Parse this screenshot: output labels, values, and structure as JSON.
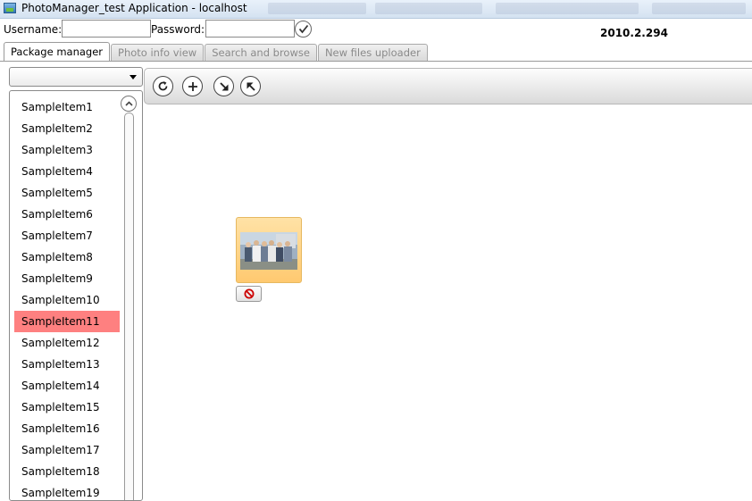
{
  "window": {
    "title": "PhotoManager_test Application - localhost"
  },
  "login": {
    "username_label": "Username:",
    "username_value": "",
    "password_label": "Password:",
    "password_value": "",
    "submit_icon": "checkmark-icon"
  },
  "version": "2010.2.294",
  "tabs": [
    {
      "label": "Package manager",
      "active": true
    },
    {
      "label": "Photo info view",
      "active": false
    },
    {
      "label": "Search and browse",
      "active": false
    },
    {
      "label": "New files uploader",
      "active": false
    }
  ],
  "package_selector": {
    "selected_value": ""
  },
  "items": [
    {
      "label": "SampleItem1"
    },
    {
      "label": "SampleItem2"
    },
    {
      "label": "SampleItem3"
    },
    {
      "label": "SampleItem4"
    },
    {
      "label": "SampleItem5"
    },
    {
      "label": "SampleItem6"
    },
    {
      "label": "SampleItem7"
    },
    {
      "label": "SampleItem8"
    },
    {
      "label": "SampleItem9"
    },
    {
      "label": "SampleItem10"
    },
    {
      "label": "SampleItem11"
    },
    {
      "label": "SampleItem12"
    },
    {
      "label": "SampleItem13"
    },
    {
      "label": "SampleItem14"
    },
    {
      "label": "SampleItem15"
    },
    {
      "label": "SampleItem16"
    },
    {
      "label": "SampleItem17"
    },
    {
      "label": "SampleItem18"
    },
    {
      "label": "SampleItem19"
    }
  ],
  "selected_item": "SampleItem11",
  "toolbar": {
    "buttons": [
      {
        "icon": "refresh-icon"
      },
      {
        "icon": "add-icon"
      },
      {
        "icon": "arrow-down-right-icon"
      },
      {
        "icon": "arrow-up-left-icon"
      }
    ]
  },
  "photo": {
    "thumbnail": "group-photo-thumbnail",
    "delete_icon": "no-entry-icon"
  },
  "colors": {
    "selected_item_bg": "#fe8080",
    "photo_card_bg": "#ffd68a"
  }
}
